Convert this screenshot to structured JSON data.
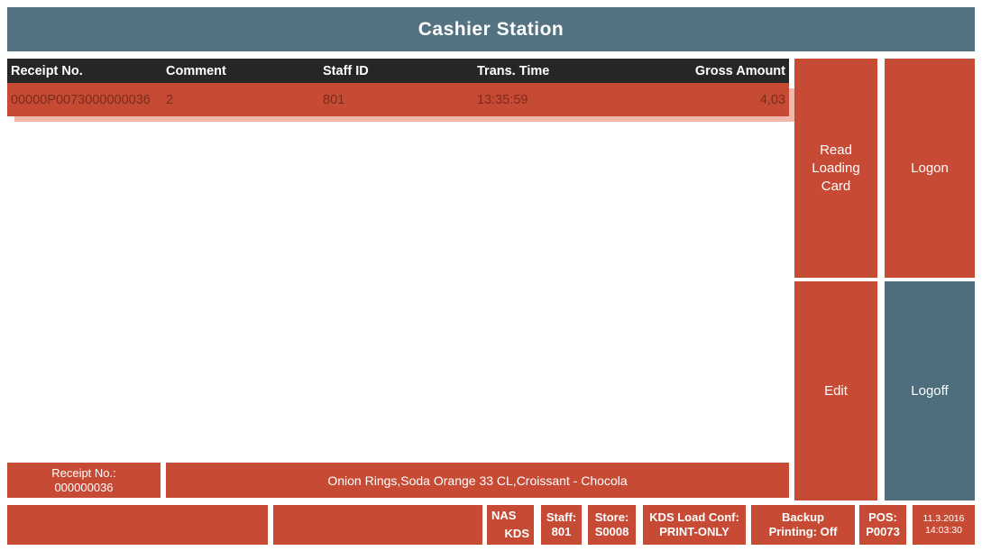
{
  "header": {
    "title": "Cashier Station"
  },
  "table": {
    "columns": [
      "Receipt No.",
      "Comment",
      "Staff ID",
      "Trans. Time",
      "Gross Amount"
    ],
    "rows": [
      {
        "receipt_no": "00000P0073000000036",
        "comment": "2",
        "staff_id": "801",
        "trans_time": "13:35:59",
        "gross_amount": "4,03"
      }
    ]
  },
  "buttons": {
    "read_loading_card": "Read Loading Card",
    "logon": "Logon",
    "edit": "Edit",
    "logoff": "Logoff"
  },
  "receipt_panel": {
    "label": "Receipt No.:",
    "value": "000000036"
  },
  "items_panel": {
    "text": "Onion Rings,Soda Orange 33 CL,Croissant - Chocola"
  },
  "status_bar": {
    "nas": "NAS",
    "kds": "KDS",
    "staff_label": "Staff:",
    "staff_value": "801",
    "store_label": "Store:",
    "store_value": "S0008",
    "kds_load_conf_label": "KDS Load Conf:",
    "kds_load_conf_value": "PRINT-ONLY",
    "backup_label": "Backup",
    "backup_value": "Printing: Off",
    "pos_label": "POS:",
    "pos_value": "P0073",
    "date": "11.3.2016",
    "time": "14:03:30"
  },
  "colors": {
    "accent_red": "#C74A35",
    "title_bar_slate": "#547382",
    "logoff_slate": "#4E6E7E",
    "table_header_dark": "#262626",
    "row_text_maroon": "#7B2B1C",
    "selection_shadow_pink": "#F1B7AA",
    "text_white": "#FFFFFF",
    "page_background": "#FFFFFF"
  }
}
